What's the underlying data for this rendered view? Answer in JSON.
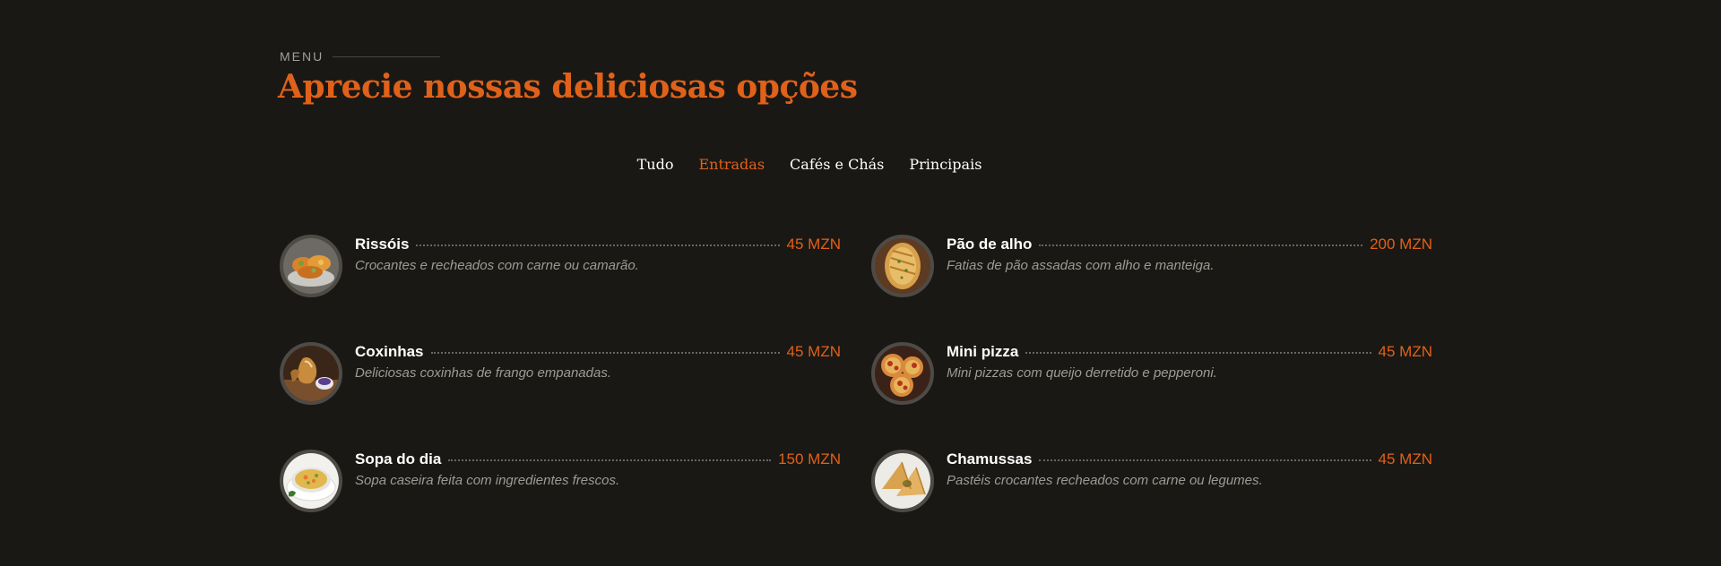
{
  "section": {
    "eyebrow": "MENU",
    "title": "Aprecie nossas deliciosas opções"
  },
  "tabs": [
    {
      "label": "Tudo",
      "active": false
    },
    {
      "label": "Entradas",
      "active": true
    },
    {
      "label": "Cafés e Chás",
      "active": false
    },
    {
      "label": "Principais",
      "active": false
    }
  ],
  "items": [
    {
      "name": "Rissóis",
      "price": "45 MZN",
      "description": "Crocantes e recheados com carne ou camarão.",
      "image": "rissois-photo"
    },
    {
      "name": "Pão de alho",
      "price": "200 MZN",
      "description": "Fatias de pão assadas com alho e manteiga.",
      "image": "garlic-bread-photo"
    },
    {
      "name": "Coxinhas",
      "price": "45 MZN",
      "description": "Deliciosas coxinhas de frango empanadas.",
      "image": "coxinhas-photo"
    },
    {
      "name": "Mini pizza",
      "price": "45 MZN",
      "description": "Mini pizzas com queijo derretido e pepperoni.",
      "image": "mini-pizza-photo"
    },
    {
      "name": "Sopa do dia",
      "price": "150 MZN",
      "description": "Sopa caseira feita com ingredientes frescos.",
      "image": "soup-photo"
    },
    {
      "name": "Chamussas",
      "price": "45 MZN",
      "description": "Pastéis crocantes recheados com carne ou legumes.",
      "image": "chamussas-photo"
    }
  ],
  "colors": {
    "background": "#1a1814",
    "accent": "#e0611a",
    "text": "#ffffff",
    "muted": "#9e9b96"
  }
}
